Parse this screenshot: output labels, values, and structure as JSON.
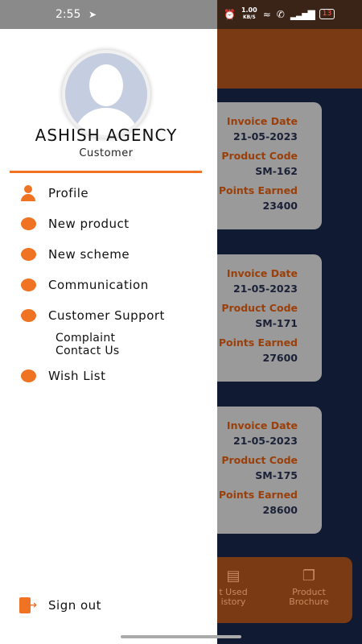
{
  "status_bar": {
    "time": "2:55",
    "net_speed_value": "1.00",
    "net_speed_unit": "KB/S",
    "battery": "13"
  },
  "drawer": {
    "name": "ASHISH AGENCY",
    "role": "Customer",
    "menu": {
      "profile": "Profile",
      "new_product": "New product",
      "new_scheme": "New scheme",
      "communication": "Communication",
      "customer_support": "Customer Support",
      "complaint": "Complaint",
      "contact_us": "Contact Us",
      "wish_list": "Wish List"
    },
    "sign_out": "Sign out"
  },
  "cards": [
    {
      "invoice_label": "Invoice Date",
      "invoice_date": "21-05-2023",
      "product_label": "Product Code",
      "product_code": "SM-162",
      "points_label": "Points Earned",
      "points": "23400"
    },
    {
      "invoice_label": "Invoice Date",
      "invoice_date": "21-05-2023",
      "product_label": "Product Code",
      "product_code": "SM-171",
      "points_label": "Points Earned",
      "points": "27600"
    },
    {
      "invoice_label": "Invoice Date",
      "invoice_date": "21-05-2023",
      "product_label": "Product Code",
      "product_code": "SM-175",
      "points_label": "Points Earned",
      "points": "28600"
    }
  ],
  "bottom_nav": {
    "point_used_line1": "t Used",
    "point_used_line2": "istory",
    "brochure_line1": "Product",
    "brochure_line2": "Brochure"
  },
  "colors": {
    "accent": "#ef7323",
    "header": "#7a3a13",
    "background": "#111a33"
  }
}
